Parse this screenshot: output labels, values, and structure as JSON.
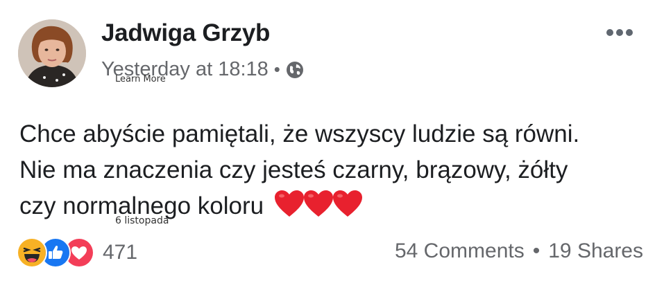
{
  "post": {
    "author": "Jadwiga Grzyb",
    "timestamp": "Yesterday at 18:18",
    "separator": "•",
    "privacy_icon": "globe-icon",
    "text_lines": [
      "Chce abyście pamiętali, że wszyscy ludzie są równi.",
      "Nie ma znaczenia czy jesteś czarny, brązowy, żółty",
      "czy normalnego koloru"
    ],
    "emoji": [
      "heart",
      "heart",
      "heart"
    ],
    "heart_color": "#e8212e"
  },
  "overlay": {
    "learn_more": "Learn More",
    "date": "6 listopada"
  },
  "footer": {
    "reactions": [
      "haha",
      "like",
      "love"
    ],
    "reaction_count": "471",
    "comments": "54 Comments",
    "separator": "•",
    "shares": "19 Shares"
  },
  "colors": {
    "text": "#1c1e21",
    "secondary": "#65676b",
    "like_blue": "#1877f2",
    "love_red": "#f33e58",
    "haha_yellow": "#f7b125"
  }
}
